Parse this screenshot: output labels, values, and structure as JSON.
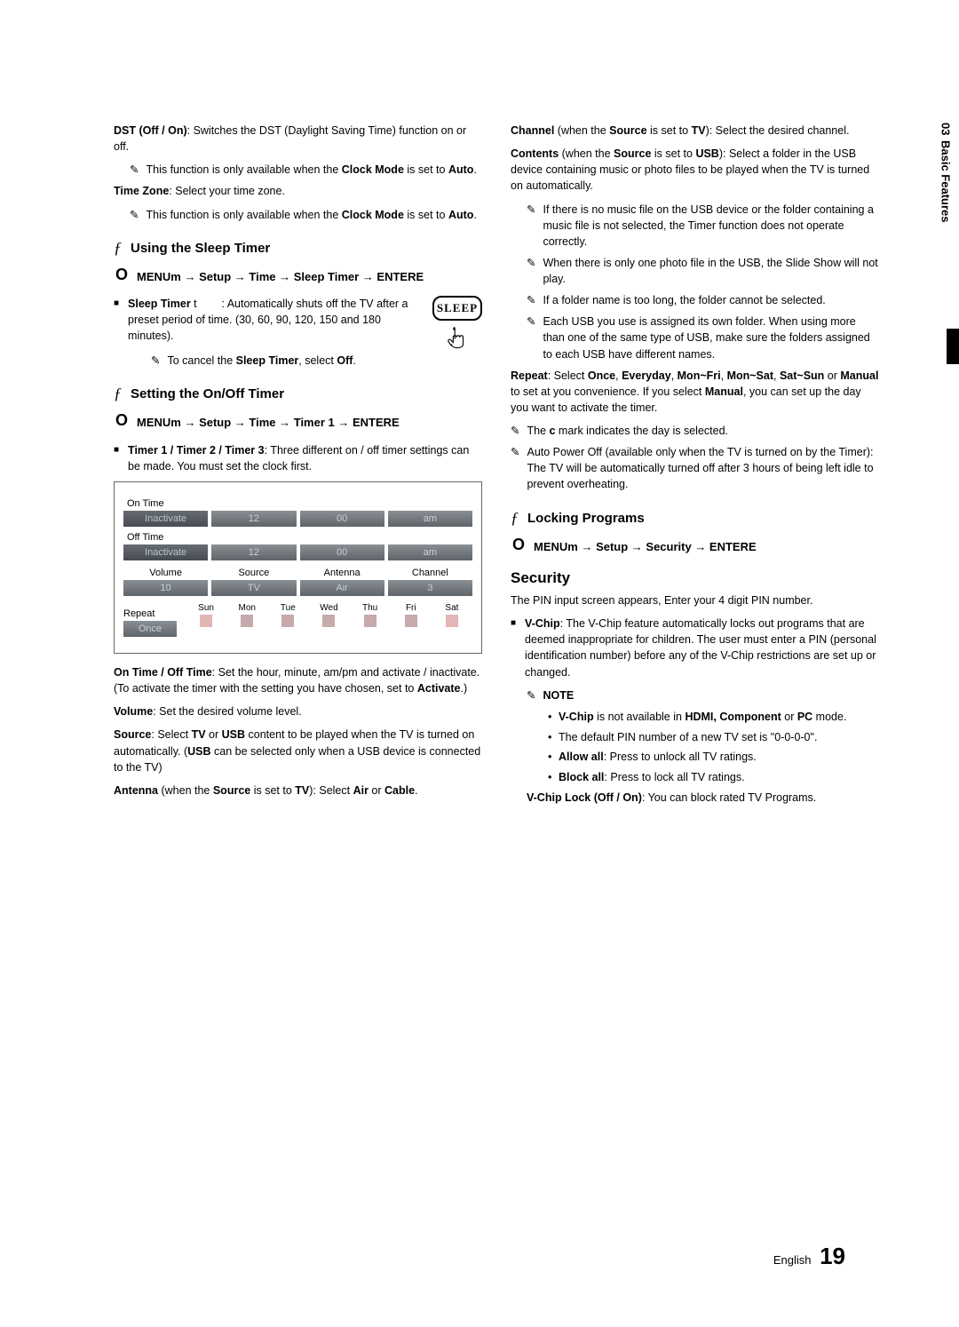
{
  "side": {
    "chapter": "03",
    "label": "Basic Features"
  },
  "left": {
    "dst": {
      "lead_bold": "DST (Off / On)",
      "lead_rest": ": Switches the DST (Daylight Saving Time) function on or off.",
      "tip1_a": "This function is only available when the ",
      "tip1_b": "Clock Mode",
      "tip1_c": " is set to ",
      "tip1_d": "Auto",
      "tip1_e": ".",
      "tz_bold": "Time Zone",
      "tz_rest": ": Select your time zone.",
      "tip2_a": "This function is only available when the ",
      "tip2_b": "Clock Mode",
      "tip2_c": " is set to ",
      "tip2_d": "Auto",
      "tip2_e": "."
    },
    "sleep": {
      "heading": "Using the Sleep Timer",
      "menu": "MENUm  → Setup → Time → Sleep Timer → ENTERE",
      "b1a": "Sleep Timer",
      "b1b": " t",
      "b1c": ": Automatically shuts off the TV after a preset period of time. (30, 60, 90, 120, 150 and 180 minutes).",
      "btn": "SLEEP",
      "cancel_a": "To cancel the ",
      "cancel_b": "Sleep Timer",
      "cancel_c": ", select ",
      "cancel_d": "Off",
      "cancel_e": "."
    },
    "onoff": {
      "heading": "Setting the On/Off Timer",
      "menu": "MENUm  → Setup → Time → Timer 1 → ENTERE",
      "b1a": "Timer 1 / Timer 2 / Timer 3",
      "b1b": ": Three different on / off timer settings can be made. You must set the clock first."
    },
    "timerbox": {
      "ontime": "On Time",
      "offtime": "Off Time",
      "inactivate": "Inactivate",
      "h": "12",
      "m": "00",
      "ap": "am",
      "volume_h": "Volume",
      "source_h": "Source",
      "antenna_h": "Antenna",
      "channel_h": "Channel",
      "volume": "10",
      "source": "TV",
      "antenna": "Air",
      "channel": "3",
      "repeat_h": "Repeat",
      "repeat_v": "Once",
      "days": [
        "Sun",
        "Mon",
        "Tue",
        "Wed",
        "Thu",
        "Fri",
        "Sat"
      ]
    },
    "below": {
      "p1a": "On Time / Off Time",
      "p1b": ": Set the hour, minute, am/pm and activate / inactivate. (To activate the timer with the setting you have chosen, set to ",
      "p1c": "Activate",
      "p1d": ".)",
      "p2a": "Volume",
      "p2b": ": Set the desired volume level.",
      "p3a": "Source",
      "p3b": ": Select ",
      "p3c": "TV",
      "p3d": " or ",
      "p3e": "USB",
      "p3f": " content to be played when the TV is turned on automatically. (",
      "p3g": "USB",
      "p3h": " can be selected only when a USB device is connected to the TV)",
      "p4a": "Antenna",
      "p4b": " (when the ",
      "p4c": "Source",
      "p4d": " is set to ",
      "p4e": "TV",
      "p4f": "): Select ",
      "p4g": "Air",
      "p4h": " or ",
      "p4i": "Cable",
      "p4j": "."
    }
  },
  "right": {
    "top": {
      "p1a": "Channel",
      "p1b": " (when the ",
      "p1c": "Source",
      "p1d": " is set to ",
      "p1e": "TV",
      "p1f": "): Select the desired channel.",
      "p2a": "Contents",
      "p2b": " (when the ",
      "p2c": "Source",
      "p2d": " is set to ",
      "p2e": "USB",
      "p2f": "): Select a folder in the USB device containing music or photo files to be played when the TV is turned on automatically.",
      "t1": "If there is no music file on the USB device or the folder containing a music file is not selected, the Timer function does not operate correctly.",
      "t2": "When there is only one photo file in the USB, the Slide Show will not play.",
      "t3": "If a folder name is too long, the folder cannot be selected.",
      "t4": "Each USB you use is assigned its own folder. When using more than one of the same type of USB, make sure the folders assigned to each USB have different names.",
      "rep_a": "Repeat",
      "rep_b": ": Select ",
      "rep_c": "Once",
      "rep_d": ", ",
      "rep_e": "Everyday",
      "rep_f": ", ",
      "rep_g": "Mon~Fri",
      "rep_h": ", ",
      "rep_i": "Mon~Sat",
      "rep_j": ", ",
      "rep_k": "Sat~Sun",
      "rep_l": " or ",
      "rep_m": "Manual",
      "rep_n": " to set at you convenience. If you select ",
      "rep_o": "Manual",
      "rep_p": ", you can set up the day you want to activate the timer.",
      "cmark_a": "The ",
      "cmark_b": "c",
      "cmark_c": " mark indicates the day is selected.",
      "apo": "Auto Power Off (available only when the TV is turned on by the Timer): The TV will be automatically turned off after 3 hours of being left idle to prevent overheating."
    },
    "lock": {
      "heading": "Locking Programs",
      "menu": "MENUm  → Setup → Security → ENTERE"
    },
    "security": {
      "heading": "Security",
      "intro": "The PIN input screen appears, Enter your 4 digit PIN number.",
      "b1a": "V-Chip",
      "b1b": ": The V-Chip feature automatically locks out programs that are deemed inappropriate for children. The user must enter a PIN (personal identification number) before any of the V-Chip restrictions are set up or changed.",
      "note": "NOTE",
      "n1a": "V-Chip",
      "n1b": " is not available in ",
      "n1c": "HDMI, Component",
      "n1d": " or ",
      "n1e": "PC",
      "n1f": " mode.",
      "n2": "The default PIN number of a new TV set is \"0-0-0-0\".",
      "n3a": "Allow all",
      "n3b": ": Press to unlock all TV ratings.",
      "n4a": "Block all",
      "n4b": ": Press to lock all TV ratings.",
      "vclock_a": "V-Chip Lock (Off / On)",
      "vclock_b": ": You can block rated TV Programs."
    }
  },
  "footer": {
    "lang": "English",
    "page": "19"
  }
}
